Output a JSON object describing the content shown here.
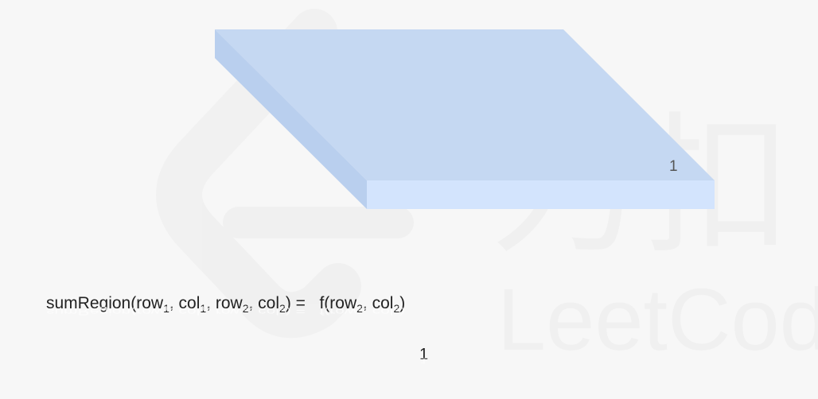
{
  "slab": {
    "cell_value": "1",
    "top_color": "#c5d8f2",
    "front_color": "#d3e4fd",
    "side_color": "#b9cfee"
  },
  "formula": {
    "fn": "sumRegion(",
    "row": "row",
    "col": "col",
    "sub1": "1",
    "sub2": "2",
    "comma": ", ",
    "eq": ") =",
    "rhs_fn": "f(",
    "rhs_close": ")"
  },
  "result": "1",
  "watermark": {
    "text": "LeetCode",
    "glyphs": "力扣"
  }
}
